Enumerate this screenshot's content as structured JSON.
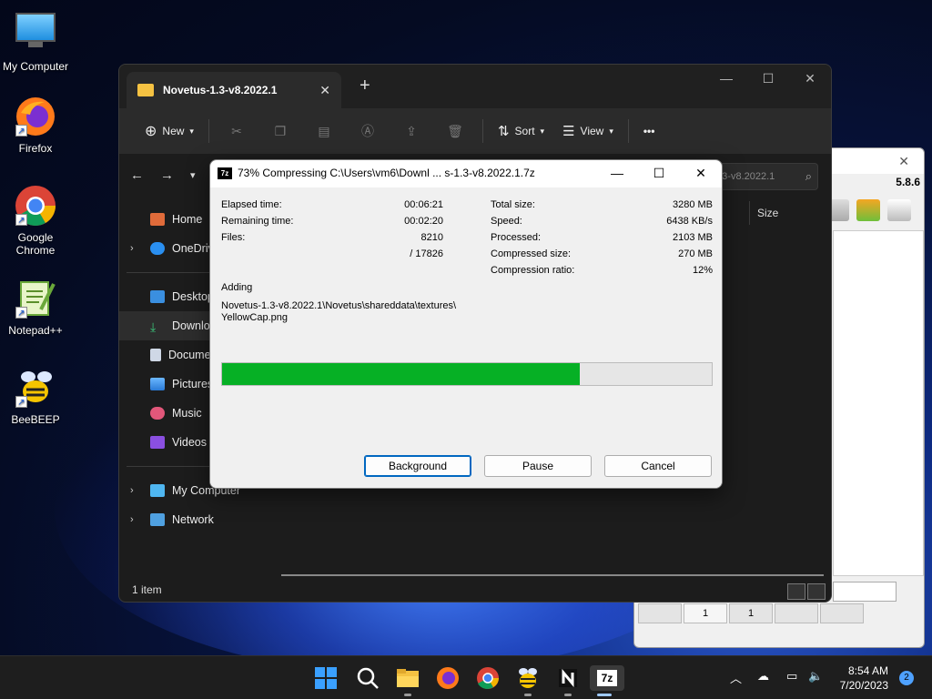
{
  "desktop": {
    "icons": [
      {
        "label": "My Computer"
      },
      {
        "label": "Firefox"
      },
      {
        "label": "Google Chrome"
      },
      {
        "label": "Notepad++"
      },
      {
        "label": "BeeBEEP"
      }
    ]
  },
  "explorer": {
    "tab_title": "Novetus-1.3-v8.2022.1",
    "toolbar": {
      "new_label": "New",
      "sort_label": "Sort",
      "view_label": "View",
      "more_label": "•••"
    },
    "search_placeholder": "1.3-v8.2022.1",
    "column_size": "Size",
    "nav": [
      {
        "label": "Home"
      },
      {
        "label": "OneDrive"
      },
      {
        "label": "Desktop"
      },
      {
        "label": "Downloads"
      },
      {
        "label": "Documents"
      },
      {
        "label": "Pictures"
      },
      {
        "label": "Music"
      },
      {
        "label": "Videos"
      },
      {
        "label": "My Computer"
      },
      {
        "label": "Network"
      }
    ],
    "status": "1 item"
  },
  "beebeep": {
    "version": "5.8.6",
    "tabs": [
      "",
      "1",
      "1",
      "",
      ""
    ]
  },
  "dialog": {
    "title": "73% Compressing C:\\Users\\vm6\\Downl ... s-1.3-v8.2022.1.7z",
    "icon_label": "7z",
    "left_stats": [
      {
        "label": "Elapsed time:",
        "value": "00:06:21"
      },
      {
        "label": "Remaining time:",
        "value": "00:02:20"
      },
      {
        "label": "Files:",
        "value": "8210"
      },
      {
        "label": "",
        "value": "/ 17826"
      }
    ],
    "right_stats": [
      {
        "label": "Total size:",
        "value": "3280 MB"
      },
      {
        "label": "Speed:",
        "value": "6438 KB/s"
      },
      {
        "label": "Processed:",
        "value": "2103 MB"
      },
      {
        "label": "Compressed size:",
        "value": "270 MB"
      },
      {
        "label": "Compression ratio:",
        "value": "12%"
      }
    ],
    "action": "Adding",
    "current_file_line1": "Novetus-1.3-v8.2022.1\\Novetus\\shareddata\\textures\\",
    "current_file_line2": "YellowCap.png",
    "progress_fraction": 0.73,
    "buttons": {
      "background": "Background",
      "pause": "Pause",
      "cancel": "Cancel"
    }
  },
  "taskbar": {
    "time": "8:54 AM",
    "date": "7/20/2023",
    "notification_count": "2",
    "sevenzip_label": "7z"
  }
}
